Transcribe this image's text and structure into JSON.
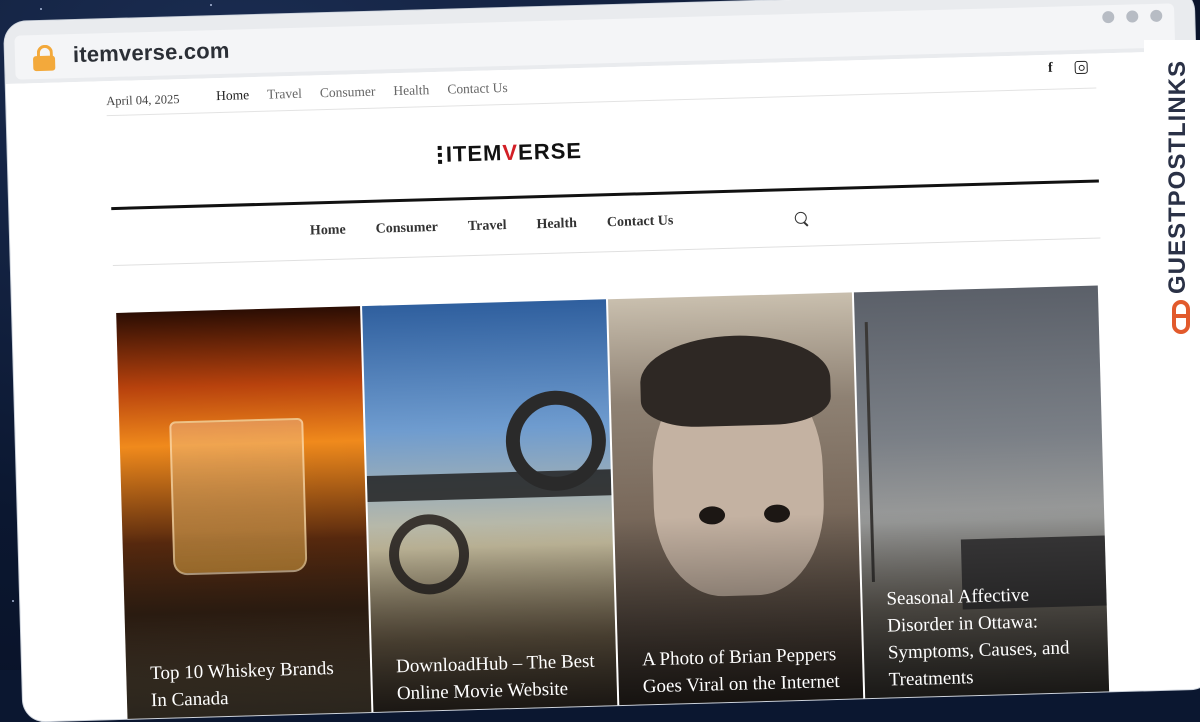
{
  "browser": {
    "url": "itemverse.com"
  },
  "topbar": {
    "date": "April 04, 2025",
    "nav": [
      "Home",
      "Travel",
      "Consumer",
      "Health",
      "Contact Us"
    ]
  },
  "site": {
    "logo_part1": "ITEM",
    "logo_v": "V",
    "logo_part2": "ERSE"
  },
  "main_nav": [
    "Home",
    "Consumer",
    "Travel",
    "Health",
    "Contact Us"
  ],
  "cards": [
    {
      "title": "Top 10 Whiskey Brands In Canada"
    },
    {
      "title": "DownloadHub – The Best Online Movie Website"
    },
    {
      "title": "A Photo of Brian Peppers Goes Viral on the Internet"
    },
    {
      "title": "Seasonal Affective Disorder in Ottawa: Symptoms, Causes, and Treatments"
    }
  ],
  "watermark": "GUESTPOSTLINKS",
  "colors": {
    "accent": "#d21f26",
    "lock": "#f3a93b",
    "watermark": "#2a3146",
    "watermark_icon": "#e25a2c"
  },
  "icons": [
    "lock-icon",
    "facebook-icon",
    "instagram-icon",
    "search-icon",
    "link-icon"
  ]
}
